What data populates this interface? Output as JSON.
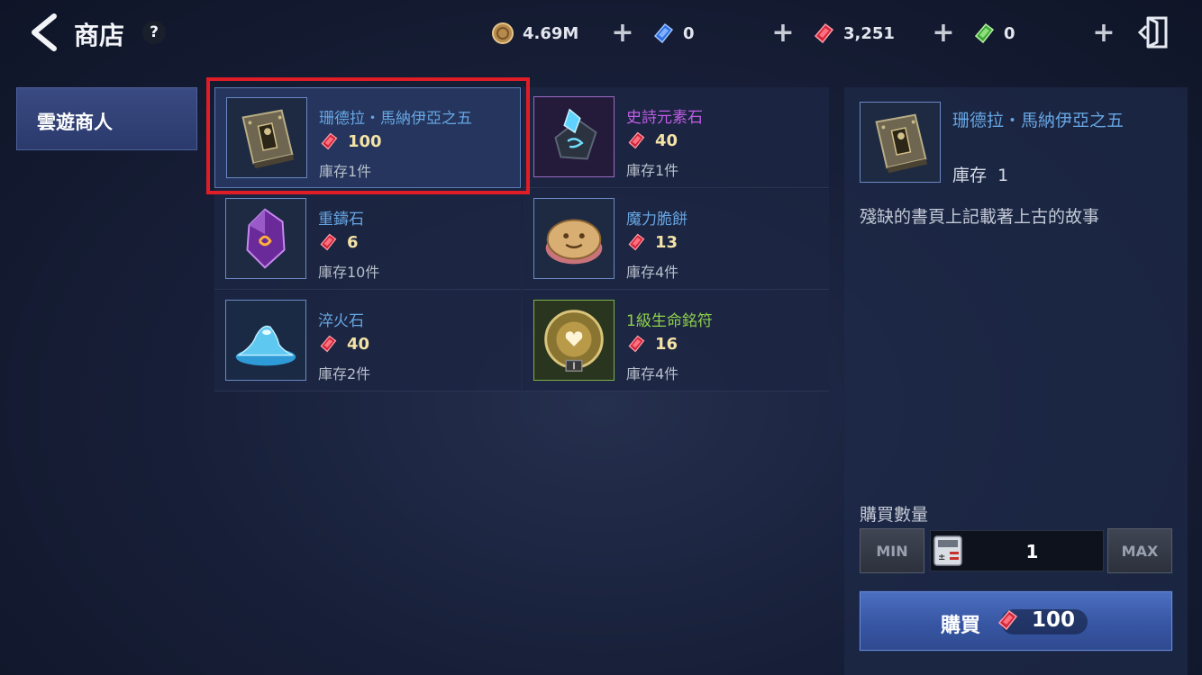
{
  "header": {
    "title": "商店",
    "help_label": "?"
  },
  "currencies": [
    {
      "icon": "gold-coin-icon",
      "value": "4.69M"
    },
    {
      "icon": "blue-diamond-icon",
      "value": "0"
    },
    {
      "icon": "red-diamond-icon",
      "value": "3,251"
    },
    {
      "icon": "green-diamond-icon",
      "value": "0"
    }
  ],
  "plus_label": "+",
  "categories": [
    {
      "label": "雲遊商人",
      "selected": true
    }
  ],
  "items": [
    {
      "name": "珊德拉・馬納伊亞之五",
      "price": "100",
      "stock": "庫存1件",
      "icon": "ancient-book-icon",
      "name_color": "#67a6e3",
      "selected": true
    },
    {
      "name": "史詩元素石",
      "price": "40",
      "stock": "庫存1件",
      "icon": "element-stone-icon",
      "name_color": "#c05ee6",
      "selected": false
    },
    {
      "name": "重鑄石",
      "price": "6",
      "stock": "庫存10件",
      "icon": "recast-stone-icon",
      "name_color": "#67a6e3",
      "selected": false
    },
    {
      "name": "魔力脆餅",
      "price": "13",
      "stock": "庫存4件",
      "icon": "magic-biscuit-icon",
      "name_color": "#67a6e3",
      "selected": false
    },
    {
      "name": "淬火石",
      "price": "40",
      "stock": "庫存2件",
      "icon": "quench-stone-icon",
      "name_color": "#67a6e3",
      "selected": false
    },
    {
      "name": "1級生命銘符",
      "price": "16",
      "stock": "庫存4件",
      "icon": "life-rune-icon",
      "name_color": "#8fd04b",
      "selected": false
    }
  ],
  "detail": {
    "name": "珊德拉・馬納伊亞之五",
    "stock_label": "庫存",
    "stock_value": "1",
    "description": "殘缺的書頁上記載著上古的故事",
    "quantity_label": "購買數量",
    "min_label": "MIN",
    "max_label": "MAX",
    "quantity": "1",
    "buy_label": "購買",
    "buy_price": "100"
  }
}
